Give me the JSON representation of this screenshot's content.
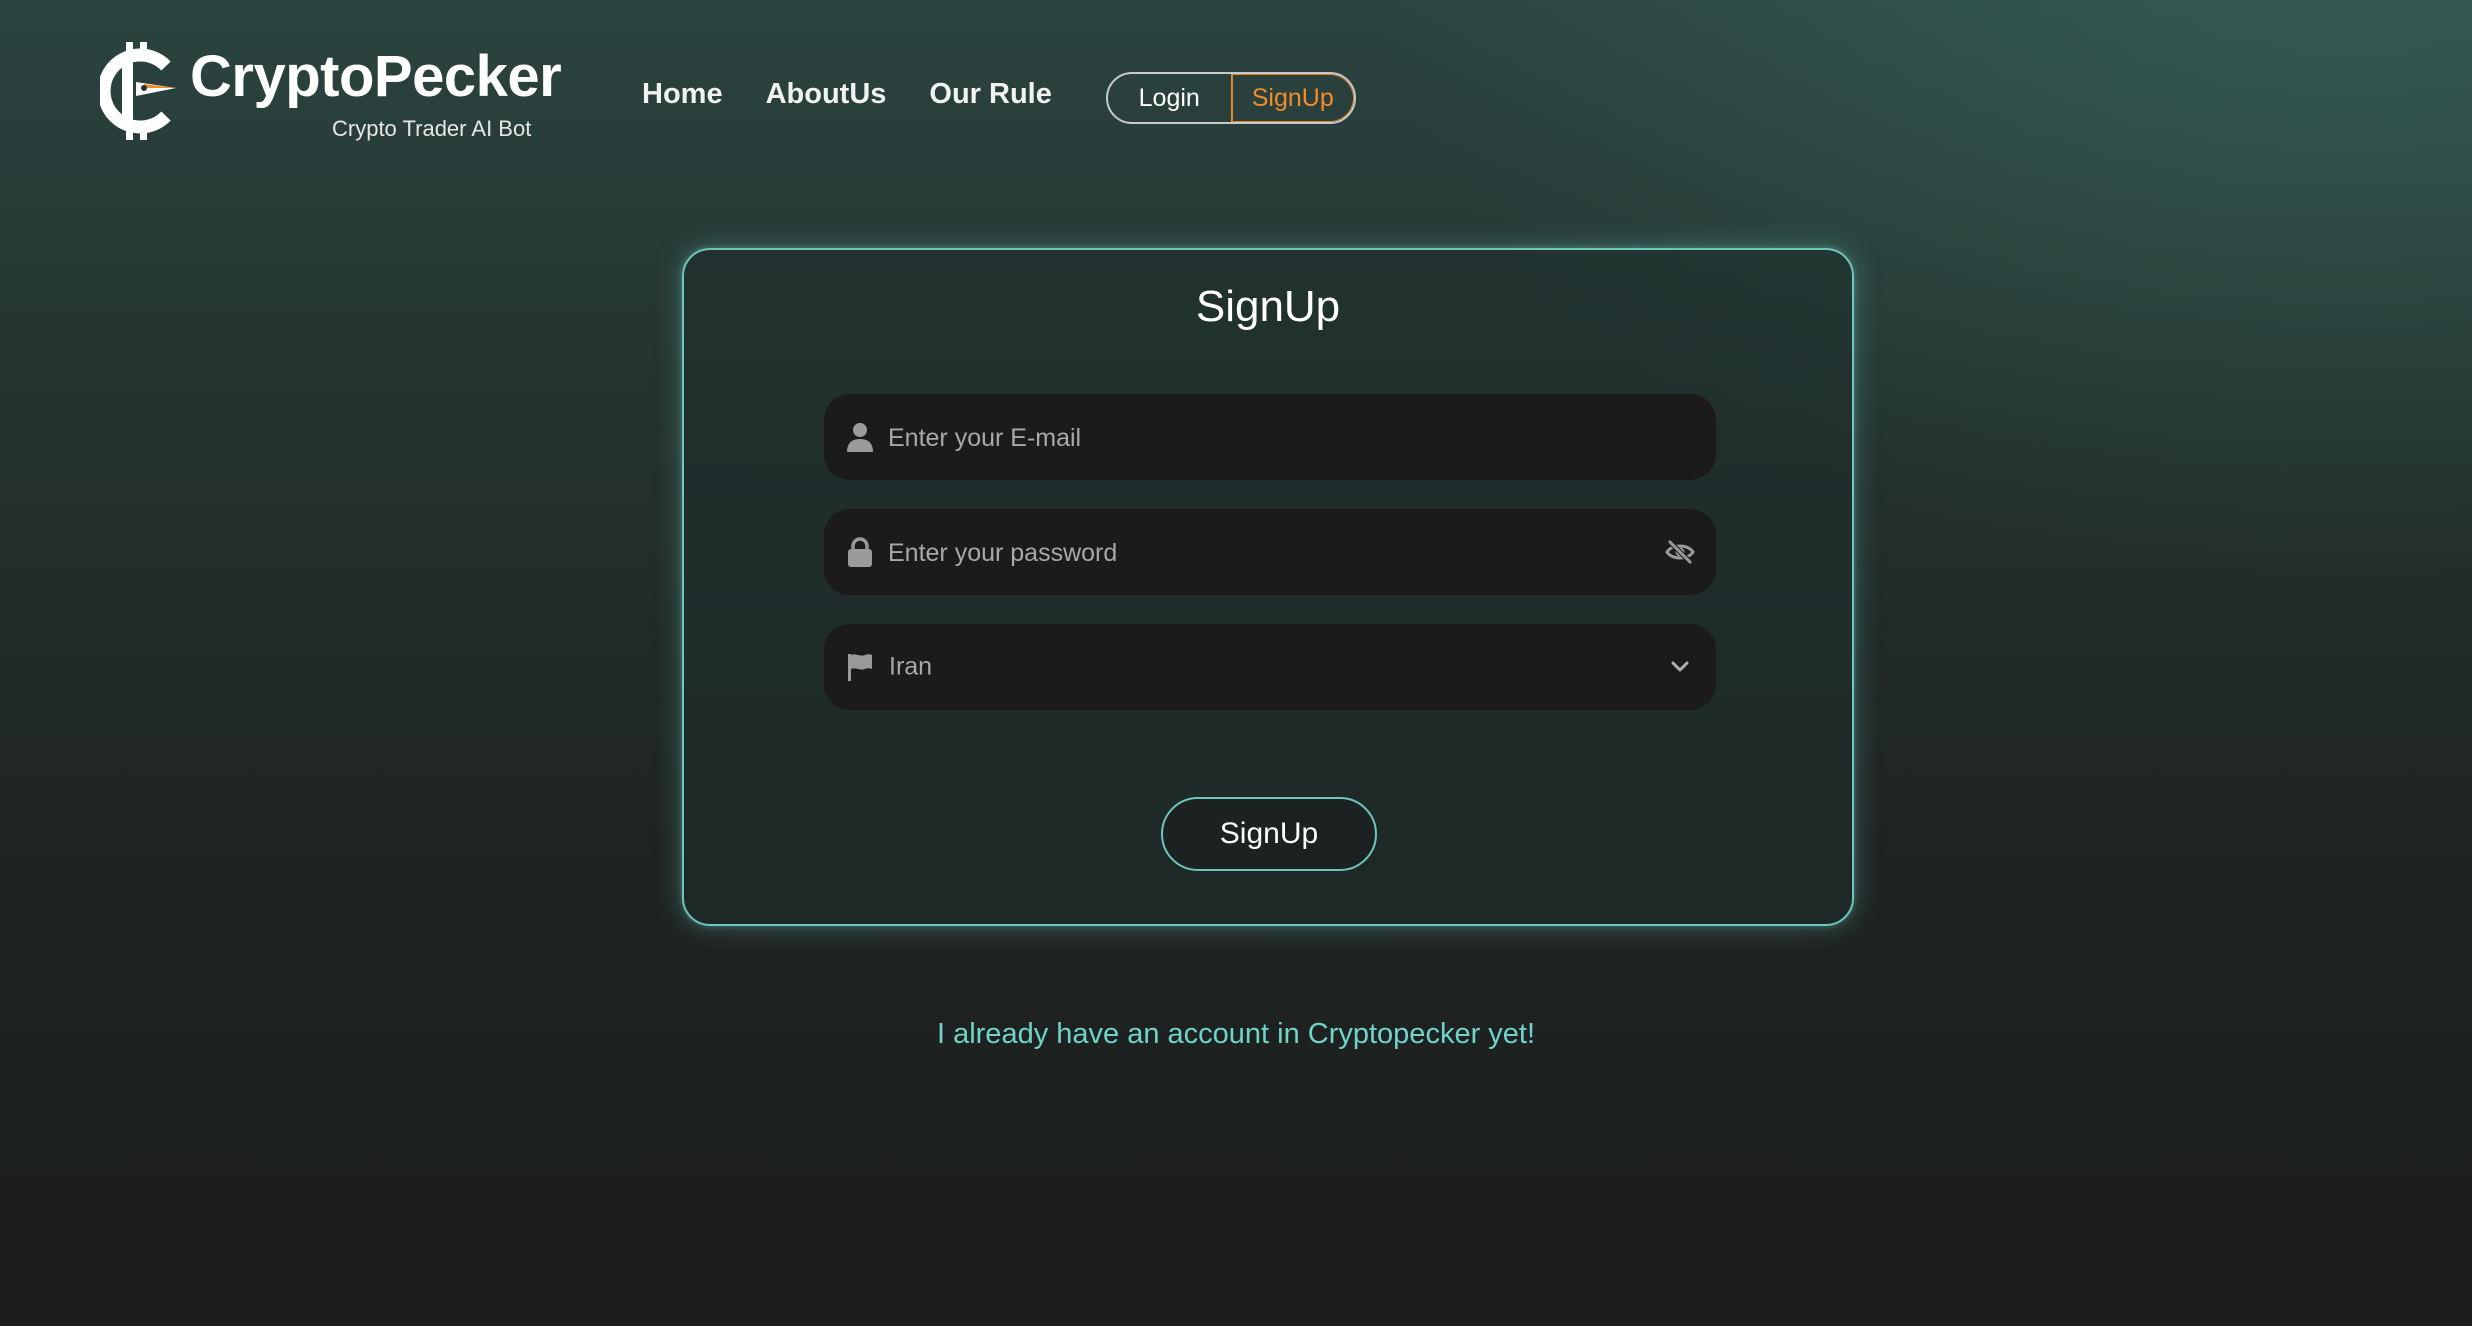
{
  "brand": {
    "name": "CryptoPecker",
    "tagline": "Crypto Trader AI Bot"
  },
  "nav": {
    "items": [
      "Home",
      "AboutUs",
      "Our Rule"
    ]
  },
  "auth_toggle": {
    "login_label": "Login",
    "signup_label": "SignUp",
    "active": "SignUp"
  },
  "form": {
    "title": "SignUp",
    "email": {
      "placeholder": "Enter your E-mail",
      "value": "",
      "icon": "user-icon"
    },
    "password": {
      "placeholder": "Enter your password",
      "value": "",
      "icon": "lock-icon",
      "toggle_icon": "eye-slash-icon"
    },
    "country": {
      "selected": "Iran",
      "icon": "flag-icon",
      "dropdown_icon": "chevron-down-icon"
    },
    "submit_label": "SignUp"
  },
  "footer_link": "I already have an account in Cryptopecker yet!",
  "colors": {
    "accent_orange": "#f28c28",
    "accent_teal": "#6fc4bd",
    "link_teal": "#6fd3c7",
    "field_bg": "#1b1b1b"
  }
}
